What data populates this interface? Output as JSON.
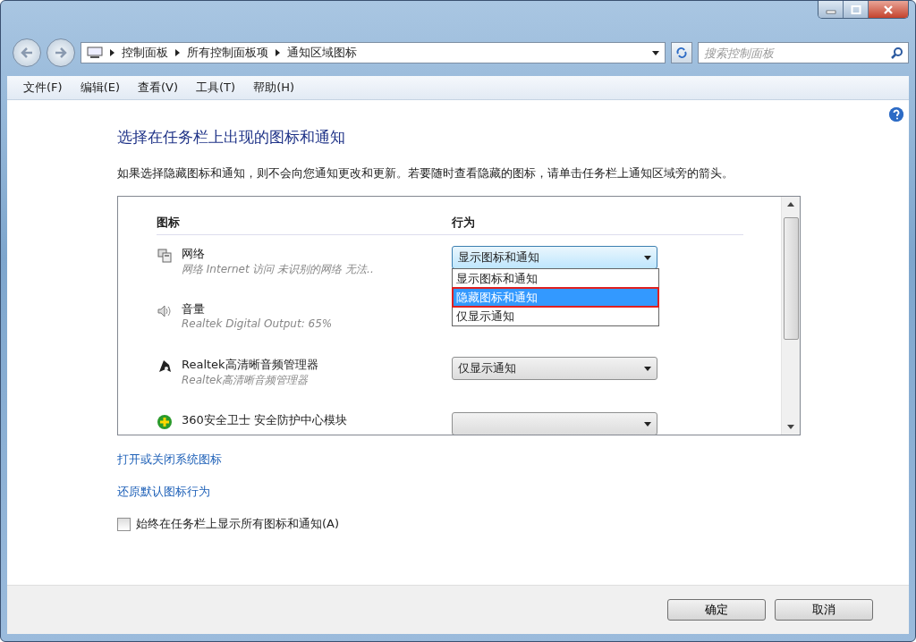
{
  "address_bar": {
    "crumbs": [
      "控制面板",
      "所有控制面板项",
      "通知区域图标"
    ]
  },
  "search": {
    "placeholder": "搜索控制面板"
  },
  "menu": [
    "文件(F)",
    "编辑(E)",
    "查看(V)",
    "工具(T)",
    "帮助(H)"
  ],
  "heading": "选择在任务栏上出现的图标和通知",
  "description": "如果选择隐藏图标和通知，则不会向您通知更改和更新。若要随时查看隐藏的图标，请单击任务栏上通知区域旁的箭头。",
  "table": {
    "columns": [
      "图标",
      "行为"
    ],
    "rows": [
      {
        "kind": "network",
        "name": "网络",
        "detail": "网络 Internet 访问 未识别的网络 无法..",
        "behavior": "显示图标和通知",
        "expanded": true,
        "options": [
          {
            "label": "显示图标和通知",
            "selected": false,
            "annotated": false
          },
          {
            "label": "隐藏图标和通知",
            "selected": true,
            "annotated": true
          },
          {
            "label": "仅显示通知",
            "selected": false,
            "annotated": false
          }
        ]
      },
      {
        "kind": "volume",
        "name": "音量",
        "detail": "Realtek Digital Output: 65%",
        "expanded": false
      },
      {
        "kind": "audio-manager",
        "name": "Realtek高清晰音频管理器",
        "detail": "Realtek高清晰音频管理器",
        "behavior": "仅显示通知",
        "expanded": false
      },
      {
        "kind": "shield",
        "name": "360安全卫士 安全防护中心模块",
        "expanded": false
      }
    ]
  },
  "links": [
    "打开或关闭系统图标",
    "还原默认图标行为"
  ],
  "always_show": {
    "label": "始终在任务栏上显示所有图标和通知(A)",
    "checked": false
  },
  "buttons": [
    "确定",
    "取消"
  ]
}
